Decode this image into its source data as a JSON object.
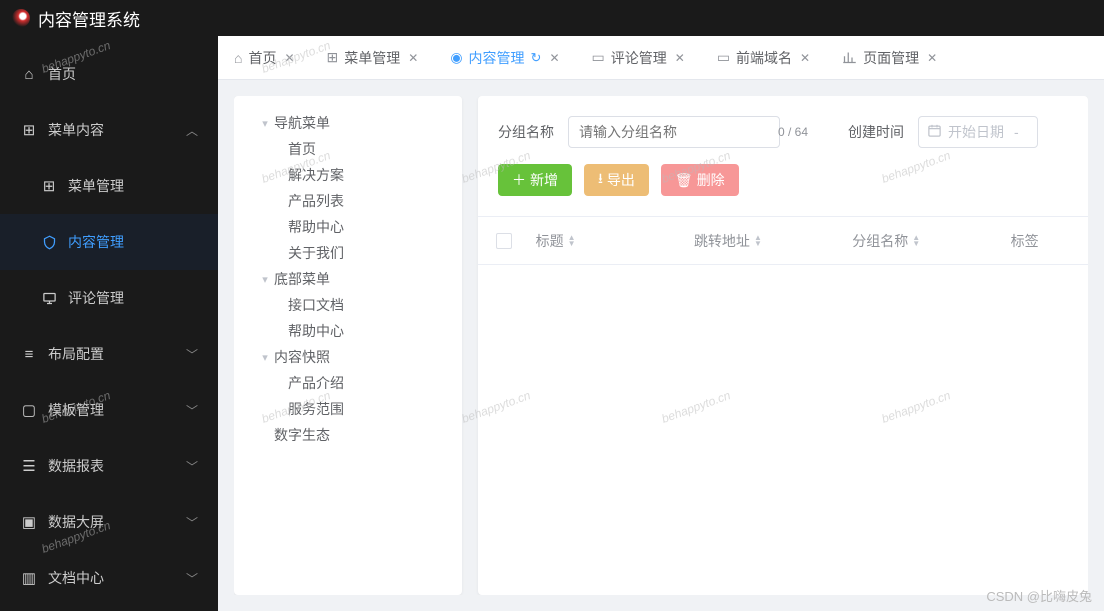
{
  "topbar": {
    "title": "内容管理系统"
  },
  "sidebar": {
    "home_label": "首页",
    "group_content_label": "菜单内容",
    "menu_mgmt_label": "菜单管理",
    "content_mgmt_label": "内容管理",
    "comment_mgmt_label": "评论管理",
    "layout_cfg_label": "布局配置",
    "template_mgmt_label": "模板管理",
    "data_report_label": "数据报表",
    "data_screen_label": "数据大屏",
    "doc_center_label": "文档中心"
  },
  "tabs": {
    "home": "首页",
    "menu_mgmt": "菜单管理",
    "content_mgmt": "内容管理",
    "comment_mgmt": "评论管理",
    "frontend_domain": "前端域名",
    "page_mgmt": "页面管理"
  },
  "tree": {
    "nav_menu": "导航菜单",
    "nav_home": "首页",
    "nav_solution": "解决方案",
    "nav_products": "产品列表",
    "nav_help": "帮助中心",
    "nav_about": "关于我们",
    "footer_menu": "底部菜单",
    "footer_api_docs": "接口文档",
    "footer_help": "帮助中心",
    "snapshot_menu": "内容快照",
    "snapshot_product_intro": "产品介绍",
    "snapshot_service_scope": "服务范围",
    "digital_eco": "数字生态"
  },
  "filters": {
    "group_name_label": "分组名称",
    "group_name_placeholder": "请输入分组名称",
    "group_name_count": "0 / 64",
    "create_time_label": "创建时间",
    "start_date_placeholder": "开始日期",
    "range_sep": "-"
  },
  "buttons": {
    "add": "新增",
    "export": "导出",
    "delete": "删除"
  },
  "table": {
    "columns": {
      "title": "标题",
      "redirect": "跳转地址",
      "group_name": "分组名称",
      "tags": "标签"
    }
  },
  "watermark_text": "behappyto.cn",
  "csdn": {
    "prefix": "CSDN @",
    "user": "比嗨皮兔"
  }
}
